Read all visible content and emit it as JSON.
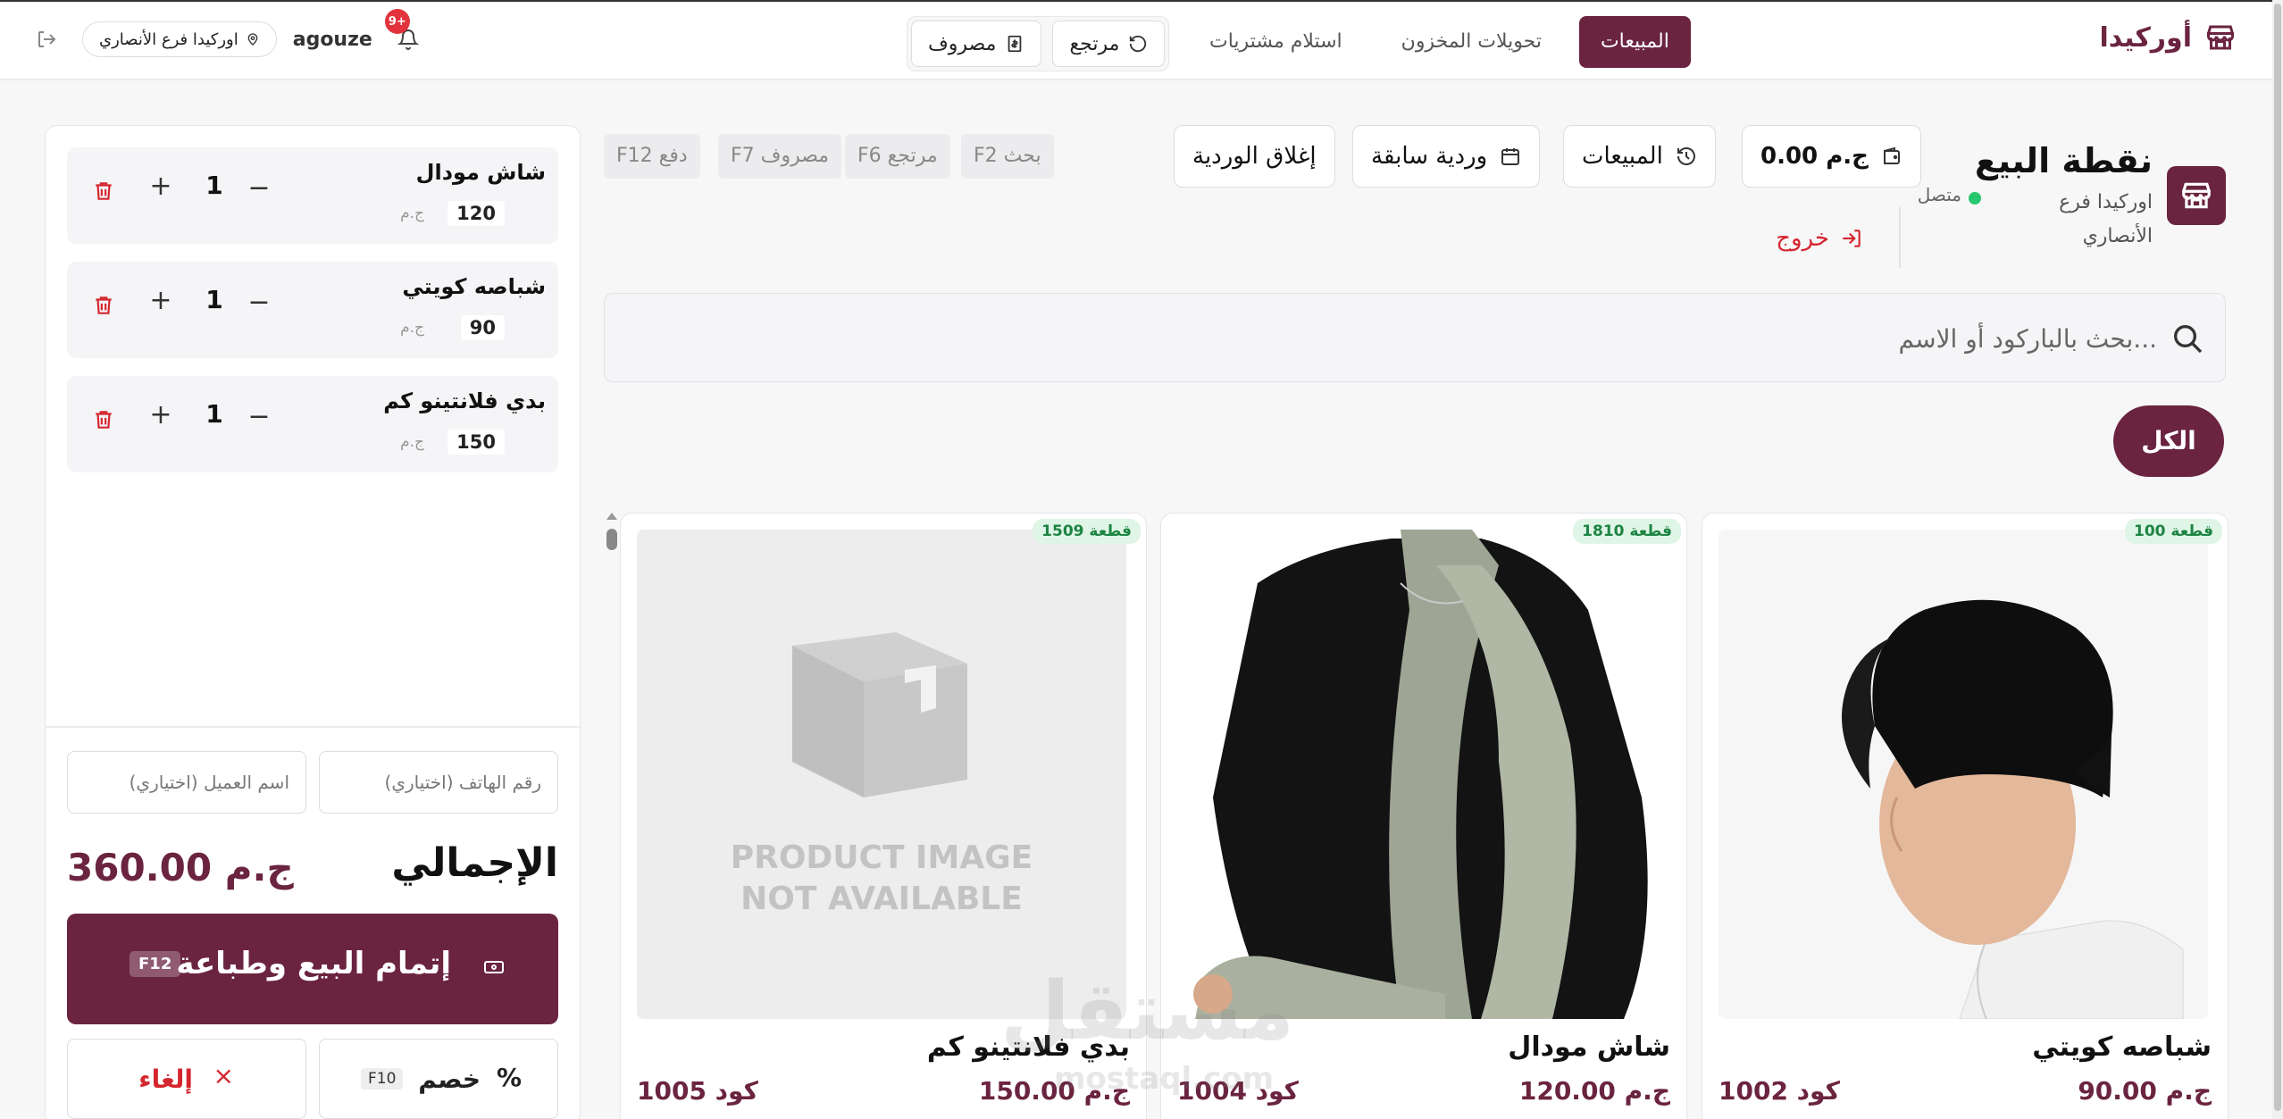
{
  "brand": {
    "name": "أوركيدا"
  },
  "nav": {
    "items": [
      {
        "label": "المبيعات",
        "active": true
      },
      {
        "label": "تحويلات المخزون",
        "active": false
      },
      {
        "label": "استلام مشتريات",
        "active": false
      }
    ]
  },
  "toolbar": {
    "return_label": "مرتجع",
    "expense_label": "مصروف"
  },
  "user": {
    "username": "agouze",
    "branch": "اوركيدا فرع الأنصاري",
    "notifications": "9+"
  },
  "pos": {
    "title": "نقطة البيع",
    "branch": "اوركيدا فرع الأنصاري",
    "status": "متصل",
    "logout": "خروج",
    "balance": "0.00 ج.م",
    "sales_button": "المبيعات",
    "previous_shift": "وردية سابقة",
    "close_shift": "إغلاق الوردية",
    "shortcuts": [
      "F2 بحث",
      "F6 مرتجع",
      "F7 مصروف",
      "F12 دفع"
    ]
  },
  "search": {
    "placeholder": "بحث بالباركود أو الاسم..."
  },
  "categories": {
    "all": "الكل"
  },
  "products": [
    {
      "name": "شباصه كويتي",
      "price": "90.00 ج.م",
      "code": "كود 1002",
      "stock": "100 قطعة",
      "image": "woman-black-hijab-cap"
    },
    {
      "name": "شاش مودال",
      "price": "120.00 ج.م",
      "code": "كود 1004",
      "stock": "1810 قطعة",
      "image": "woman-sage-scarf"
    },
    {
      "name": "بدي فلانتينو كم",
      "price": "150.00 ج.م",
      "code": "كود 1005",
      "stock": "1509 قطعة",
      "image": "placeholder-box",
      "placeholder_line1": "PRODUCT IMAGE",
      "placeholder_line2": "NOT AVAILABLE"
    }
  ],
  "cart": {
    "items": [
      {
        "name": "شاش مودال",
        "price": "120",
        "currency": "ج.م",
        "qty": "1"
      },
      {
        "name": "شباصه كويتي",
        "price": "90",
        "currency": "ج.م",
        "qty": "1"
      },
      {
        "name": "بدي فلانتينو كم",
        "price": "150",
        "currency": "ج.م",
        "qty": "1"
      }
    ],
    "phone_placeholder": "رقم الهاتف (اختياري)",
    "customer_placeholder": "اسم العميل (اختياري)",
    "total_label": "الإجمالي",
    "total_value": "360.00 ج.م",
    "checkout_label": "إتمام البيع وطباعة",
    "checkout_key": "F12",
    "discount_label": "خصم",
    "discount_symbol": "%",
    "discount_key": "F10",
    "cancel_label": "إلغاء",
    "cancel_symbol": "×"
  },
  "watermark": {
    "main": "مستقل",
    "sub": "mostaql.com"
  },
  "colors": {
    "brand": "#6b2440",
    "danger": "#d4262e",
    "success": "#28c76f",
    "stock_bg": "#dff5e6"
  }
}
